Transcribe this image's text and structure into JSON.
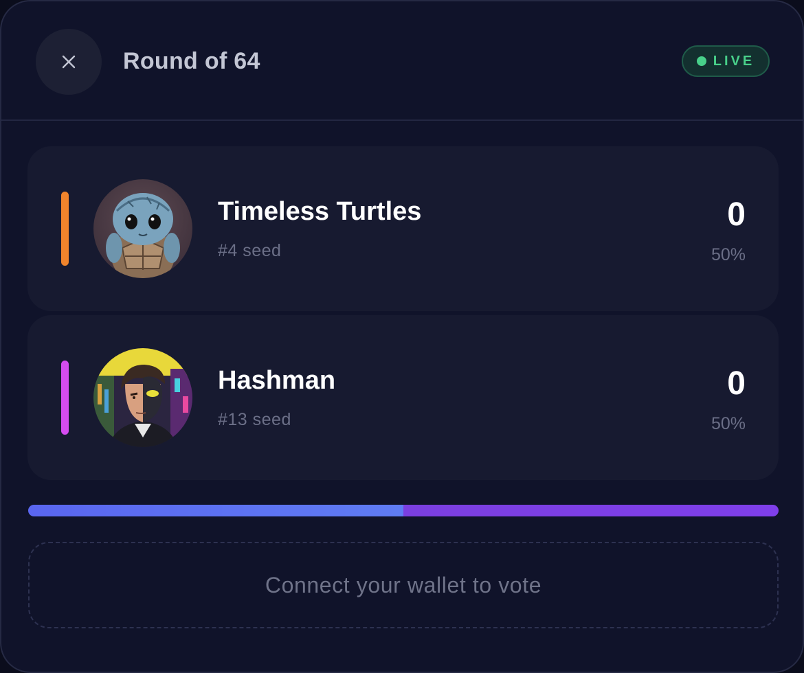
{
  "header": {
    "title": "Round of 64",
    "close_icon": "close-icon",
    "status": {
      "label": "LIVE",
      "color": "#48d08a"
    }
  },
  "matchup": {
    "contenders": [
      {
        "name": "Timeless Turtles",
        "seed": "#4 seed",
        "votes": "0",
        "percent": "50%",
        "accent": "#f0842c",
        "avatar": "turtle-avatar"
      },
      {
        "name": "Hashman",
        "seed": "#13 seed",
        "votes": "0",
        "percent": "50%",
        "accent": "#d54cf0",
        "avatar": "hashman-avatar"
      }
    ],
    "vote_share": {
      "first": 0.5,
      "second": 0.5
    },
    "progress_colors": {
      "first": "#5a6ef1",
      "second": "#7b3fe5"
    }
  },
  "cta": {
    "connect_label": "Connect your wallet to vote"
  }
}
